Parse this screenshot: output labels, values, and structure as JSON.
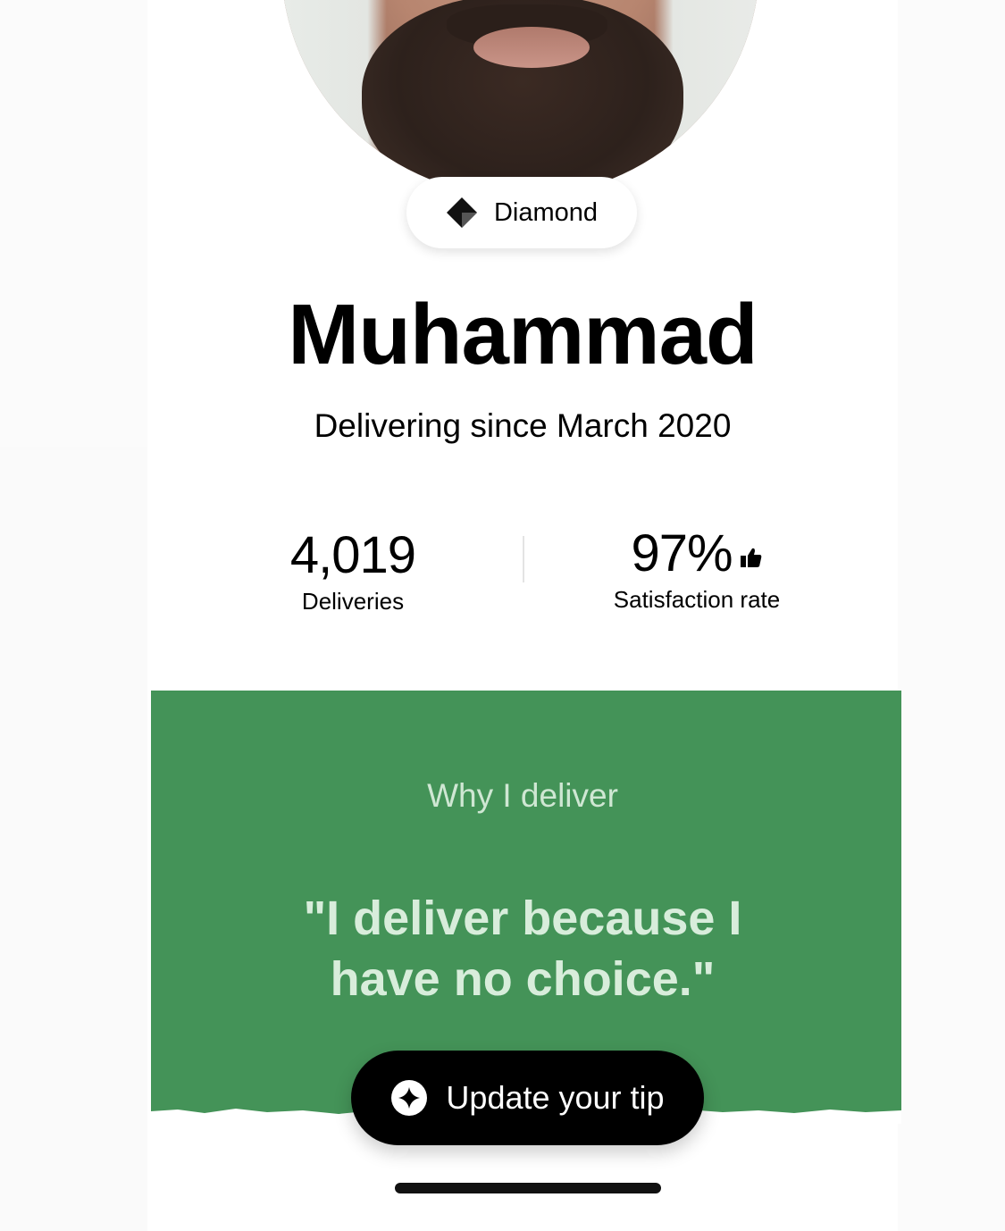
{
  "profile": {
    "tier": "Diamond",
    "tier_icon": "diamond-icon",
    "name": "Muhammad",
    "since": "Delivering since March 2020"
  },
  "stats": {
    "deliveries_value": "4,019",
    "deliveries_label": "Deliveries",
    "satisfaction_value": "97%",
    "satisfaction_label": "Satisfaction rate",
    "satisfaction_icon": "thumbs-up-icon"
  },
  "why": {
    "heading": "Why I deliver",
    "quote": "\"I deliver because I have no choice.\""
  },
  "actions": {
    "tip_label": "Update your tip",
    "tip_icon": "sparkle-icon"
  },
  "colors": {
    "accent_green": "#449358",
    "quote_text": "#d8eddb",
    "button_bg": "#000000"
  }
}
